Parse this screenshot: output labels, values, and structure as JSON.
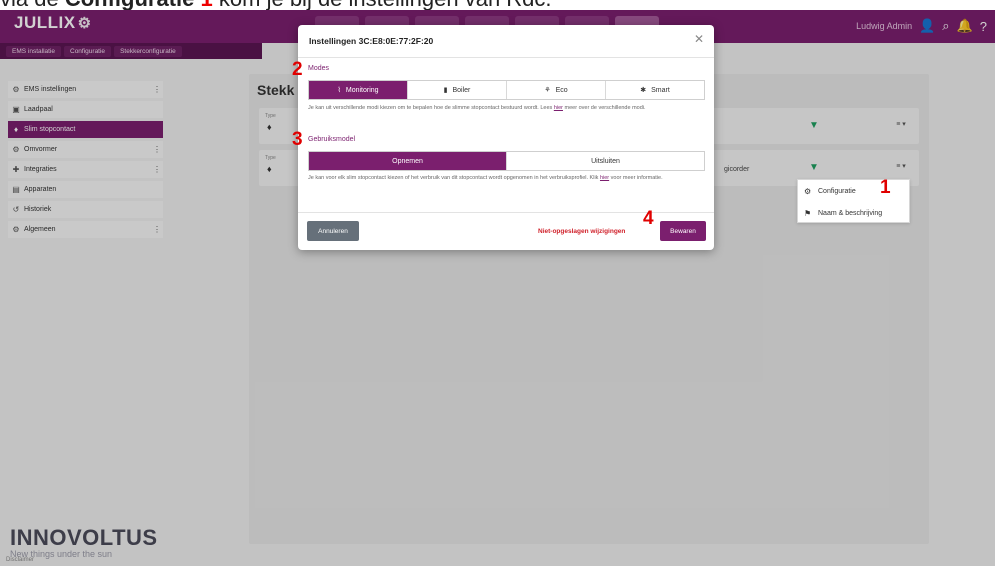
{
  "caption": {
    "prefix": "via de",
    "bold": "Configuratie",
    "number": "1",
    "suffix": "kom je bij de instellingen van Rdc."
  },
  "app": {
    "logo": "JULLIX",
    "user_label": "Ludwig Admin",
    "breadcrumb": [
      "EMS installatie",
      "Configuratie",
      "Stekkerconfiguratie"
    ]
  },
  "sidebar": {
    "items": [
      {
        "label": "EMS instellingen",
        "icon": "gear-icon",
        "more": true
      },
      {
        "label": "Laadpaal",
        "icon": "charger-icon",
        "more": false
      },
      {
        "label": "Slim stopcontact",
        "icon": "plug-icon",
        "more": false,
        "active": true
      },
      {
        "label": "Omvormer",
        "icon": "gear-icon",
        "more": true
      },
      {
        "label": "Integraties",
        "icon": "puzzle-icon",
        "more": true
      },
      {
        "label": "Apparaten",
        "icon": "device-icon",
        "more": false
      },
      {
        "label": "Historiek",
        "icon": "history-icon",
        "more": false
      },
      {
        "label": "Algemeen",
        "icon": "gear-icon",
        "more": true
      }
    ],
    "brand_name": "INNOVOLTUS",
    "brand_slogan": "New things under the sun"
  },
  "main": {
    "title": "Stekk",
    "rows": [
      {
        "type_label": "Type",
        "extra": ""
      },
      {
        "type_label": "Type",
        "extra": "gicorder"
      }
    ],
    "menu_label": "≡ ▾"
  },
  "context_menu": {
    "items": [
      {
        "label": "Configuratie",
        "icon": "gear-icon"
      },
      {
        "label": "Naam & beschrijving",
        "icon": "tag-icon"
      }
    ]
  },
  "modal": {
    "title": "Instellingen 3C:E8:0E:77:2F:20",
    "modes_label": "Modes",
    "modes": [
      {
        "label": "Monitoring",
        "glyph": "⌇",
        "selected": true
      },
      {
        "label": "Boiler",
        "glyph": "▮",
        "selected": false
      },
      {
        "label": "Eco",
        "glyph": "⚘",
        "selected": false
      },
      {
        "label": "Smart",
        "glyph": "✱",
        "selected": false
      }
    ],
    "modes_help_pre": "Je kan uit verschillende modi kiezen om te bepalen hoe de slimme stopcontact bestuurd wordt. Lees",
    "modes_help_link": "hier",
    "modes_help_post": "meer over de verschillende modi.",
    "usage_label": "Gebruiksmodel",
    "usage": [
      {
        "label": "Opnemen",
        "selected": true
      },
      {
        "label": "Uitsluiten",
        "selected": false
      }
    ],
    "usage_help_pre": "Je kan voor elk slim stopcontact kiezen of het verbruik van dit stopcontact wordt opgenomen in het verbruiksprofiel. Klik",
    "usage_help_link": "hier",
    "usage_help_post": "voor meer informatie.",
    "cancel_label": "Annuleren",
    "unsaved_label": "Niet-opgeslagen wijzigingen",
    "save_label": "Bewaren"
  },
  "steps": [
    "1",
    "2",
    "3",
    "4"
  ],
  "footer": "Disclaimer",
  "colors": {
    "brand": "#7b1f6e",
    "danger": "#d0202a",
    "step": "#e00000"
  }
}
